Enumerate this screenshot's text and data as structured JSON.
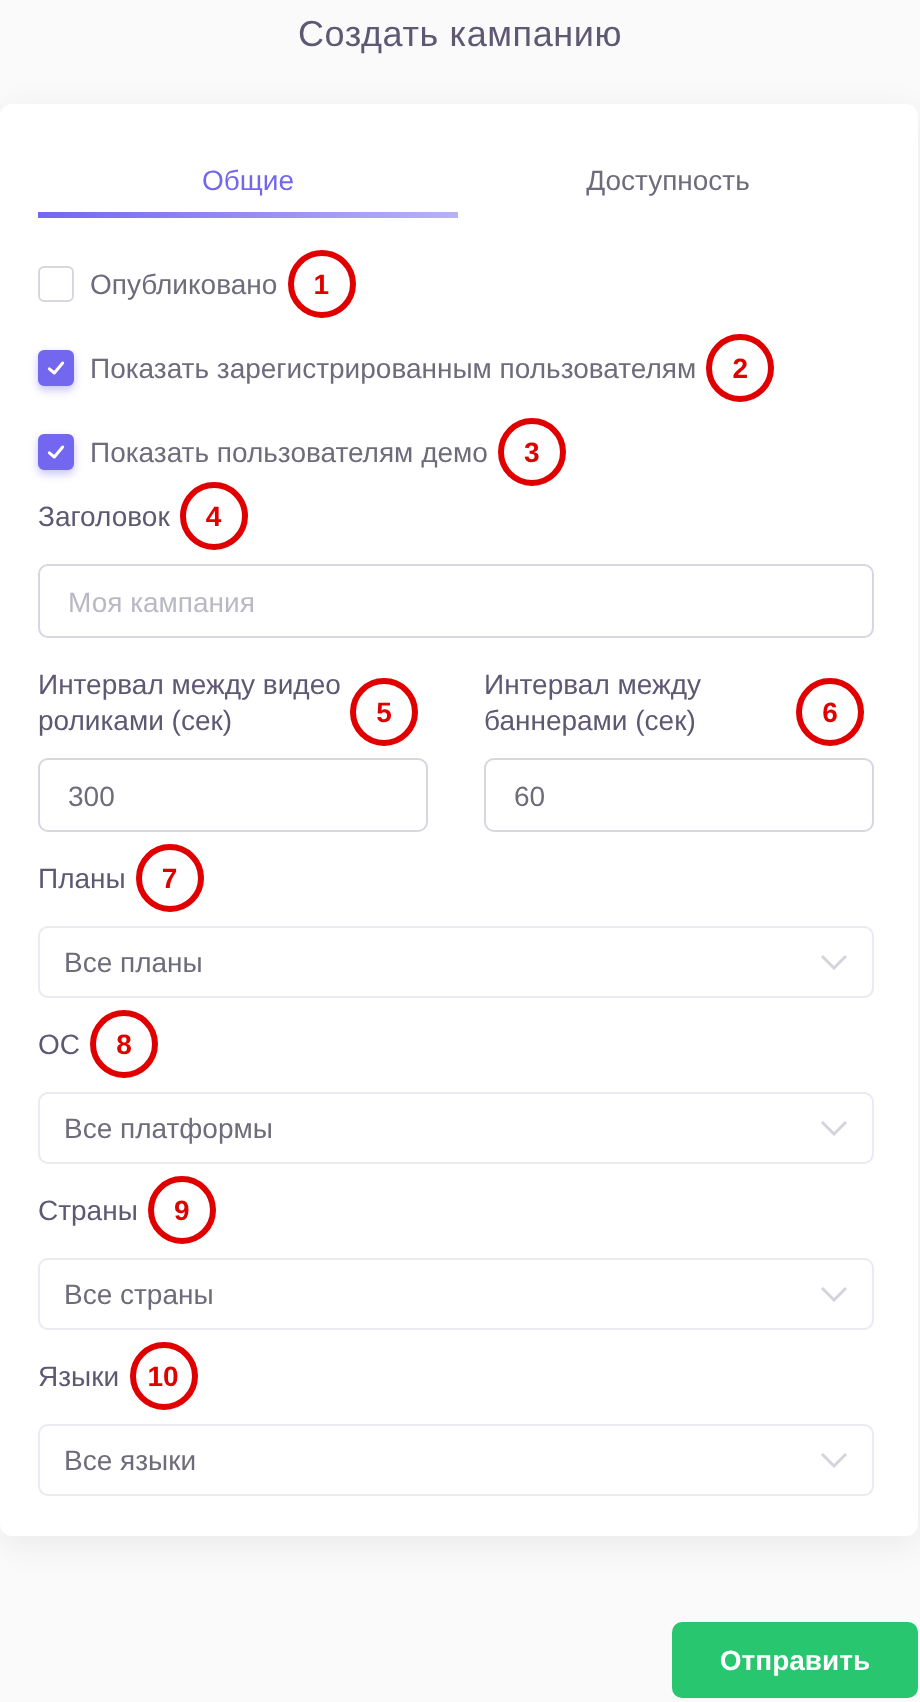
{
  "title": "Создать кампанию",
  "tabs": [
    {
      "label": "Общие",
      "selected": true
    },
    {
      "label": "Доступность",
      "selected": false
    }
  ],
  "checkboxes": [
    {
      "label": "Опубликовано",
      "checked": false,
      "marker": "1"
    },
    {
      "label": "Показать зарегистрированным пользователям",
      "checked": true,
      "marker": "2"
    },
    {
      "label": "Показать пользователям демо",
      "checked": true,
      "marker": "3"
    }
  ],
  "title_field": {
    "label": "Заголовок",
    "placeholder": "Моя кампания",
    "marker": "4"
  },
  "intervals": [
    {
      "label": "Интервал между видео роликами (сек)",
      "value": "300",
      "marker": "5"
    },
    {
      "label": "Интервал между баннерами (сек)",
      "value": "60",
      "marker": "6"
    }
  ],
  "selects": [
    {
      "label": "Планы",
      "value": "Все планы",
      "marker": "7"
    },
    {
      "label": "ОС",
      "value": "Все платформы",
      "marker": "8"
    },
    {
      "label": "Страны",
      "value": "Все страны",
      "marker": "9"
    },
    {
      "label": "Языки",
      "value": "Все языки",
      "marker": "10"
    }
  ],
  "submit": "Отправить"
}
